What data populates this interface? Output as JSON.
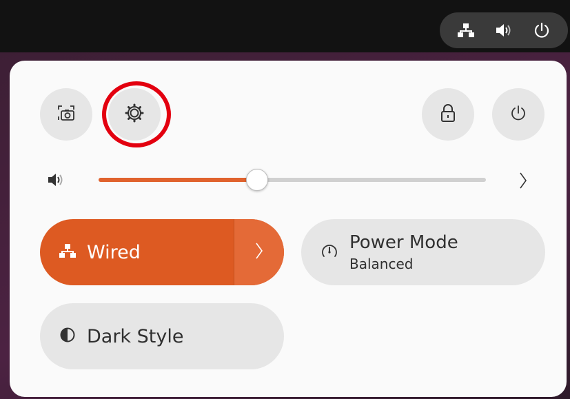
{
  "colors": {
    "accent": "#dd5a22",
    "highlight_ring": "#e3000f",
    "panel_bg": "#fafafa",
    "tile_bg": "#e6e6e6"
  },
  "top_bar": {
    "tray_icons": [
      "network-wired-icon",
      "volume-icon",
      "power-icon"
    ]
  },
  "quick_settings": {
    "buttons": [
      {
        "name": "screenshot-button",
        "icon": "screenshot-icon"
      },
      {
        "name": "settings-button",
        "icon": "gear-icon"
      },
      {
        "name": "lock-button",
        "icon": "lock-icon"
      },
      {
        "name": "power-off-button",
        "icon": "power-icon"
      }
    ],
    "volume": {
      "level": 0.41,
      "icon": "volume-icon",
      "expand_icon": "chevron-right-icon"
    },
    "tiles": {
      "wired": {
        "label": "Wired",
        "icon": "network-wired-icon",
        "active": true,
        "expand_icon": "chevron-right-icon"
      },
      "power_mode": {
        "title": "Power Mode",
        "subtitle": "Balanced",
        "icon": "power-mode-icon"
      },
      "dark_style": {
        "label": "Dark Style",
        "icon": "dark-style-icon"
      }
    }
  }
}
